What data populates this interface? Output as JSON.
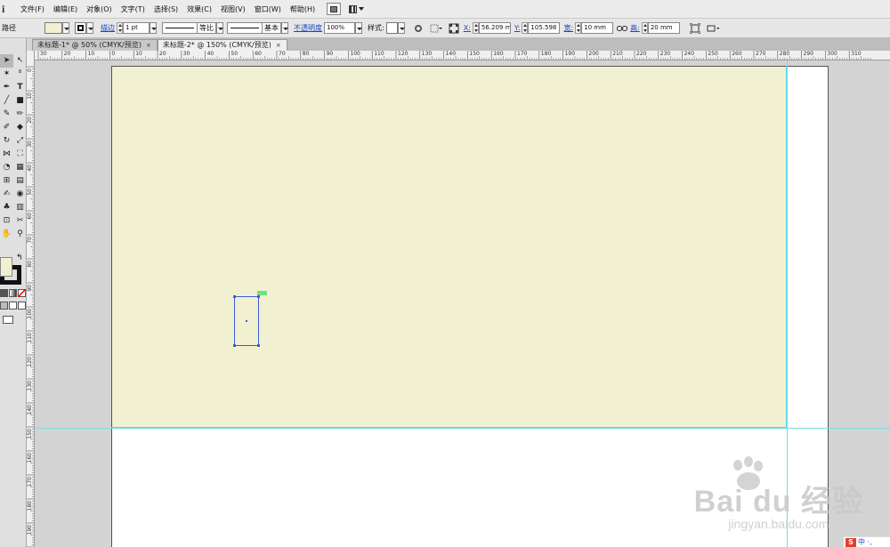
{
  "app": {
    "logo": "i"
  },
  "menu": [
    "文件(F)",
    "编辑(E)",
    "对象(O)",
    "文字(T)",
    "选择(S)",
    "效果(C)",
    "视图(V)",
    "窗口(W)",
    "帮助(H)"
  ],
  "control": {
    "tool_label": "路径",
    "stroke_label": "描边",
    "stroke_weight": "1 pt",
    "profile_label": "等比",
    "brush_label": "基本",
    "opacity_label": "不透明度",
    "opacity_value": "100%",
    "style_label": "样式:",
    "x_label": "X:",
    "x_value": "56.209 mm",
    "y_label": "Y:",
    "y_value": "105.598 mm",
    "w_label": "宽:",
    "w_value": "10 mm",
    "h_label": "高:",
    "h_value": "20 mm"
  },
  "tabs": [
    {
      "label": "未标题-1* @ 50% (CMYK/预览)",
      "close": "×",
      "active": false
    },
    {
      "label": "未标题-2* @ 150% (CMYK/预览)",
      "close": "×",
      "active": true
    }
  ],
  "ruler_top": [
    "30",
    "20",
    "10",
    "0",
    "10",
    "20",
    "30",
    "40",
    "50",
    "60",
    "70",
    "80",
    "90",
    "100",
    "110",
    "120",
    "130",
    "140",
    "150",
    "160",
    "170",
    "180",
    "190",
    "200",
    "210",
    "220",
    "230",
    "240",
    "250",
    "260",
    "270",
    "280",
    "290",
    "300",
    "310"
  ],
  "ruler_left": [
    "0",
    "10",
    "20",
    "30",
    "40",
    "50",
    "60",
    "70",
    "80",
    "90",
    "100",
    "110",
    "120",
    "130",
    "140",
    "150",
    "160",
    "170",
    "180",
    "190",
    "200"
  ],
  "colors": {
    "fill": "#f1f0d2",
    "selection": "#3c5fd6",
    "guide": "#79dbe9",
    "background_rect": "#f1f0d1"
  },
  "watermark": {
    "brand": "Bai du 经验",
    "url": "jingyan.baidu.com"
  },
  "badge": {
    "icon": "S",
    "text": "中 ·,"
  }
}
